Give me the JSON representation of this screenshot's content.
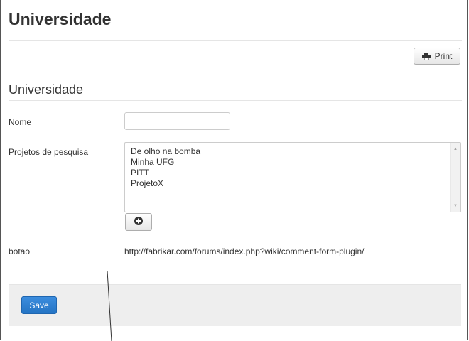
{
  "page": {
    "title": "Universidade"
  },
  "toolbar": {
    "print_label": "Print",
    "print_icon": "print-icon"
  },
  "form": {
    "section_title": "Universidade",
    "fields": {
      "nome_label": "Nome",
      "nome_value": "",
      "projetos_label": "Projetos de pesquisa",
      "projetos_items": [
        "De olho na bomba",
        "Minha UFG",
        "PITT",
        "ProjetoX"
      ],
      "add_icon": "plus-circle-icon",
      "botao_label": "botao",
      "botao_value": "http://fabrikar.com/forums/index.php?wiki/comment-form-plugin/"
    },
    "save_label": "Save"
  },
  "colors": {
    "save_button": "#2a7ccf",
    "footer_bg": "#eeeeee",
    "border": "#cccccc"
  }
}
